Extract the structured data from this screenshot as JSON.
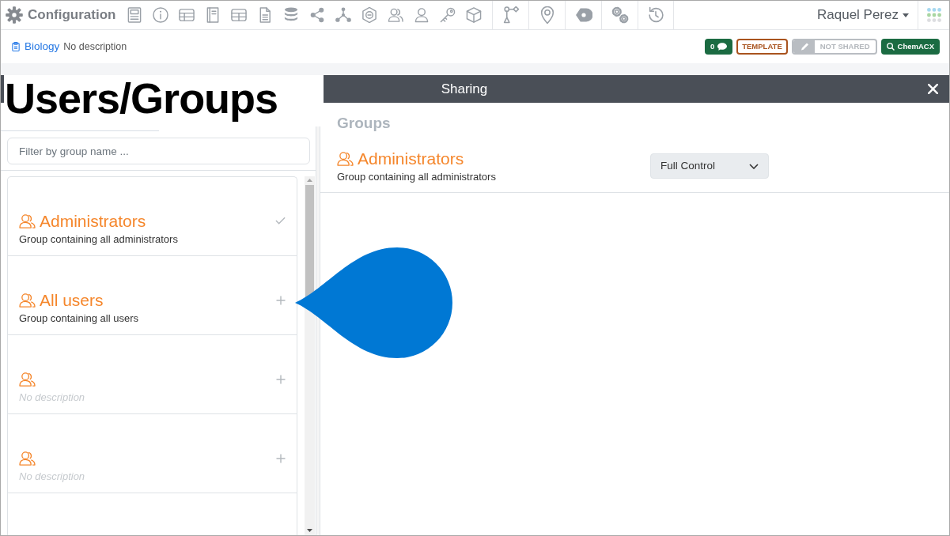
{
  "navbar": {
    "title": "Configuration",
    "user": "Raquel Perez"
  },
  "record": {
    "name": "Biology",
    "description": "No description"
  },
  "badges": [
    {
      "kind": "comments",
      "text": "0"
    },
    {
      "kind": "template",
      "text": "TEMPLATE"
    },
    {
      "kind": "sharing",
      "text": "NOT SHARED"
    },
    {
      "kind": "search",
      "text": "ChemACX"
    }
  ],
  "annotation": {
    "text": "Users/Groups"
  },
  "dialog": {
    "title": "Sharing"
  },
  "filter": {
    "placeholder": "Filter by group name ..."
  },
  "group_list": [
    {
      "kind": "named",
      "name": "Administrators",
      "description": "Group containing all administrators",
      "selected": true
    },
    {
      "kind": "named",
      "name": "All users",
      "description": "Group containing all users",
      "selected": false
    },
    {
      "kind": "unnamed",
      "description": "No description",
      "selected": false
    },
    {
      "kind": "unnamed",
      "description": "No description",
      "selected": false
    }
  ],
  "shared": {
    "heading": "Groups",
    "groups": [
      {
        "name": "Administrators",
        "description": "Group containing all administrators",
        "permission": "Full Control"
      }
    ]
  }
}
